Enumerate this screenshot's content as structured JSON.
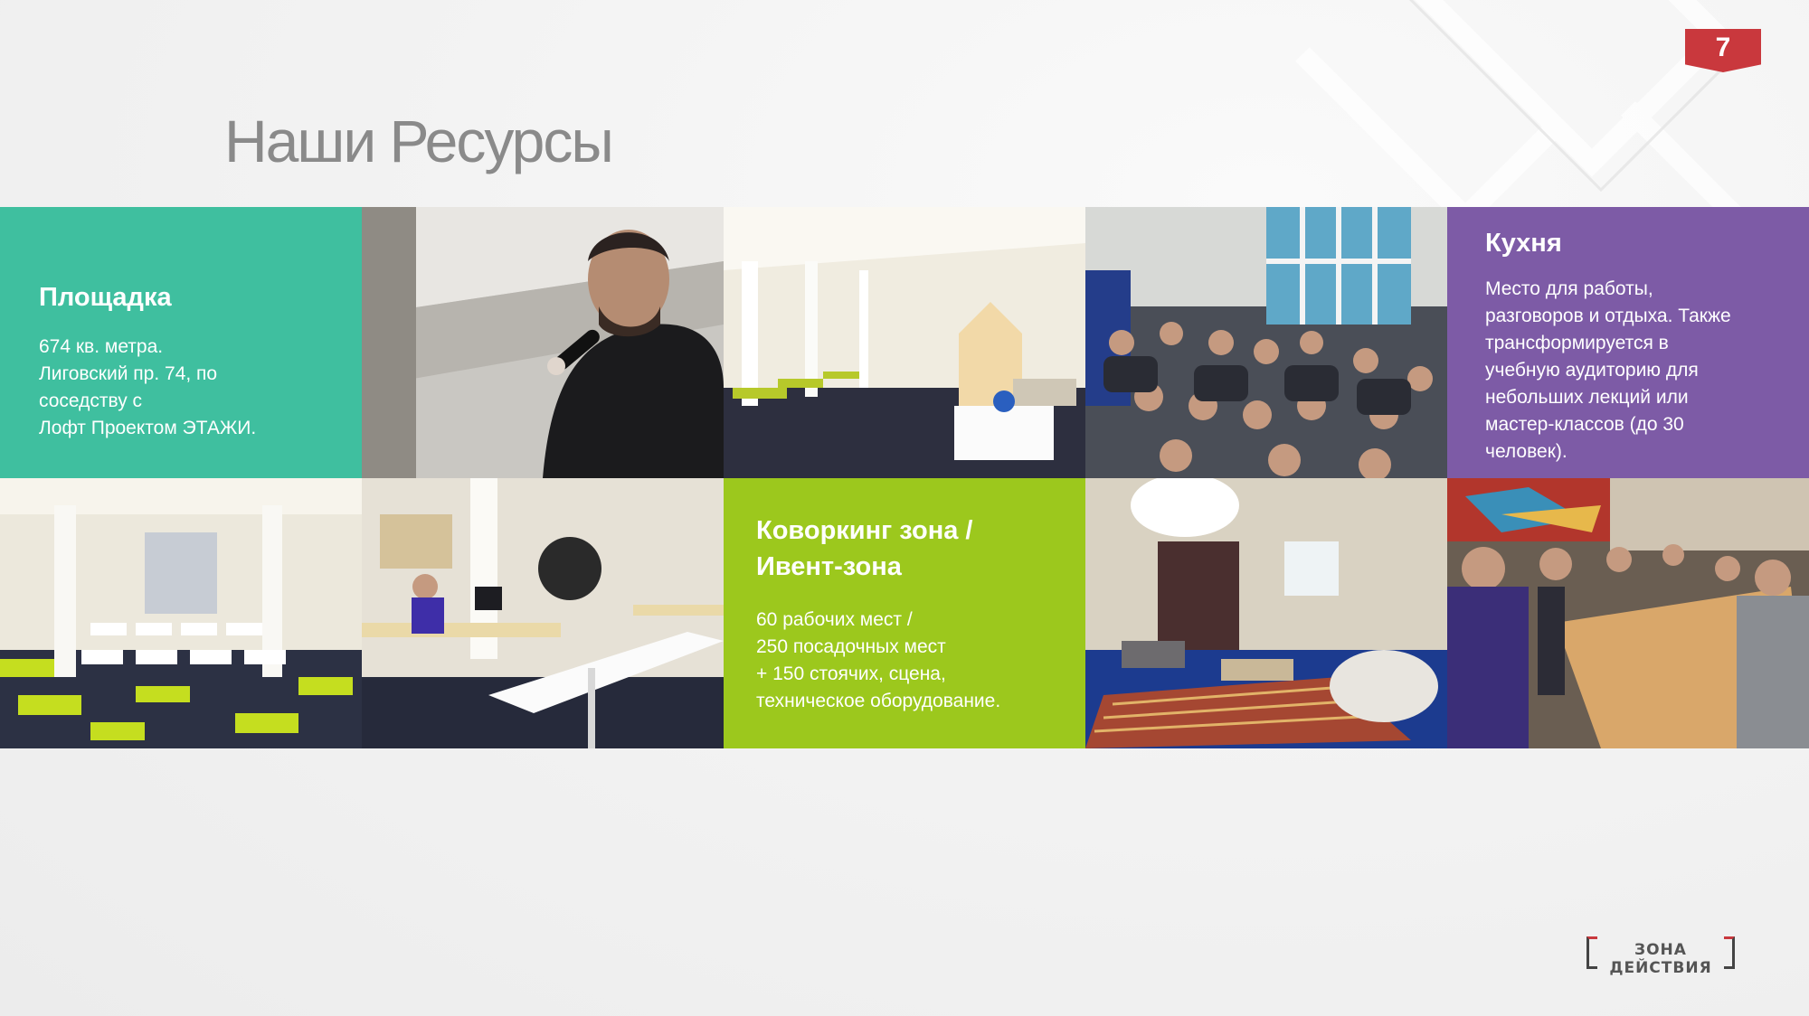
{
  "page_number": "7",
  "title": "Наши Ресурсы",
  "tiles": {
    "venue": {
      "heading": "Площадка",
      "body": "674 кв. метра.\nЛиговский пр. 74, по\nсоседству с\nЛофт Проектом ЭТАЖИ."
    },
    "kitchen": {
      "heading": "Кухня",
      "body": "Место для работы,\nразговоров и отдыха. Также\nтрансформируется в\nучебную аудиторию для\nнебольших лекций или\nмастер-классов (до 30\nчеловек)."
    },
    "coworking": {
      "heading": "Коворкинг зона /\nИвент-зона",
      "body": "60 рабочих мест /\n250 посадочных мест\n+ 150 стоячих, сцена,\nтехническое оборудование."
    }
  },
  "logo": {
    "text": "ЗОНА ДЕЙСТВИЯ"
  },
  "colors": {
    "teal": "#3fbf9f",
    "purple": "#7d5ba6",
    "lime": "#9cc81d",
    "badge_red": "#c9383d"
  }
}
